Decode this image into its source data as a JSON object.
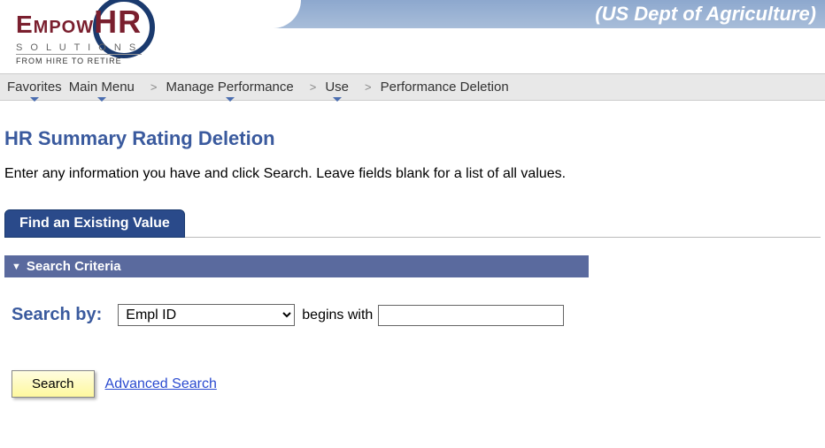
{
  "banner": {
    "org": "(US Dept of Agriculture)"
  },
  "logo": {
    "part1": "Empow",
    "part2": "HR",
    "sub1": "S O L U T I O N S",
    "sub2": "FROM HIRE TO RETIRE"
  },
  "breadcrumb": {
    "items": [
      {
        "label": "Favorites",
        "dropdown": true
      },
      {
        "label": "Main Menu",
        "dropdown": true
      },
      {
        "label": "Manage Performance",
        "dropdown": true
      },
      {
        "label": "Use",
        "dropdown": true
      },
      {
        "label": "Performance Deletion",
        "dropdown": false
      }
    ]
  },
  "page": {
    "title": "HR Summary Rating Deletion",
    "instruction": "Enter any information you have and click Search. Leave fields blank for a list of all values."
  },
  "tab": {
    "label": "Find an Existing Value"
  },
  "criteria": {
    "header": "Search Criteria",
    "search_by_label": "Search by:",
    "select_value": "Empl ID",
    "operator": "begins with",
    "input_value": ""
  },
  "actions": {
    "search_label": "Search",
    "advanced_label": "Advanced Search"
  }
}
